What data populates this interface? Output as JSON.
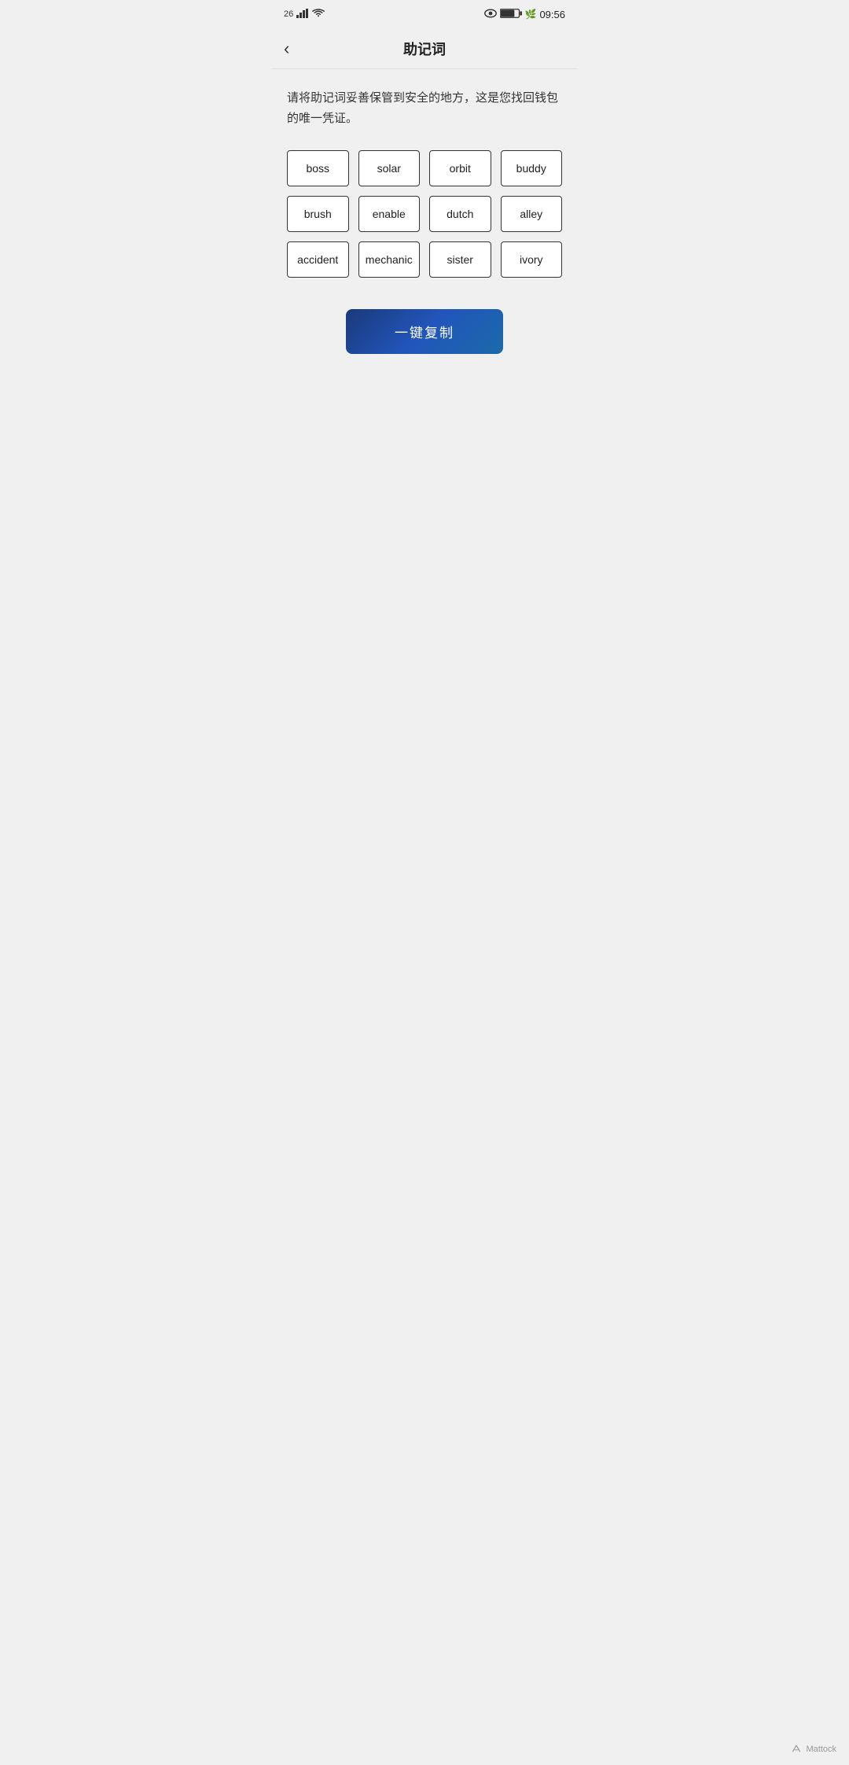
{
  "statusBar": {
    "network": "26",
    "signal": "▐▌▌",
    "wifi": "WiFi",
    "batteryIcon": "76",
    "time": "09:56"
  },
  "nav": {
    "back_label": "‹",
    "title": "助记词"
  },
  "description": "请将助记词妥善保管到安全的地方，这是您找回钱包的唯一凭证。",
  "words": [
    "boss",
    "solar",
    "orbit",
    "buddy",
    "brush",
    "enable",
    "dutch",
    "alley",
    "accident",
    "mechanic",
    "sister",
    "ivory"
  ],
  "copyButton": {
    "label": "一键复制"
  },
  "footer": {
    "watermark": "Mattock"
  }
}
